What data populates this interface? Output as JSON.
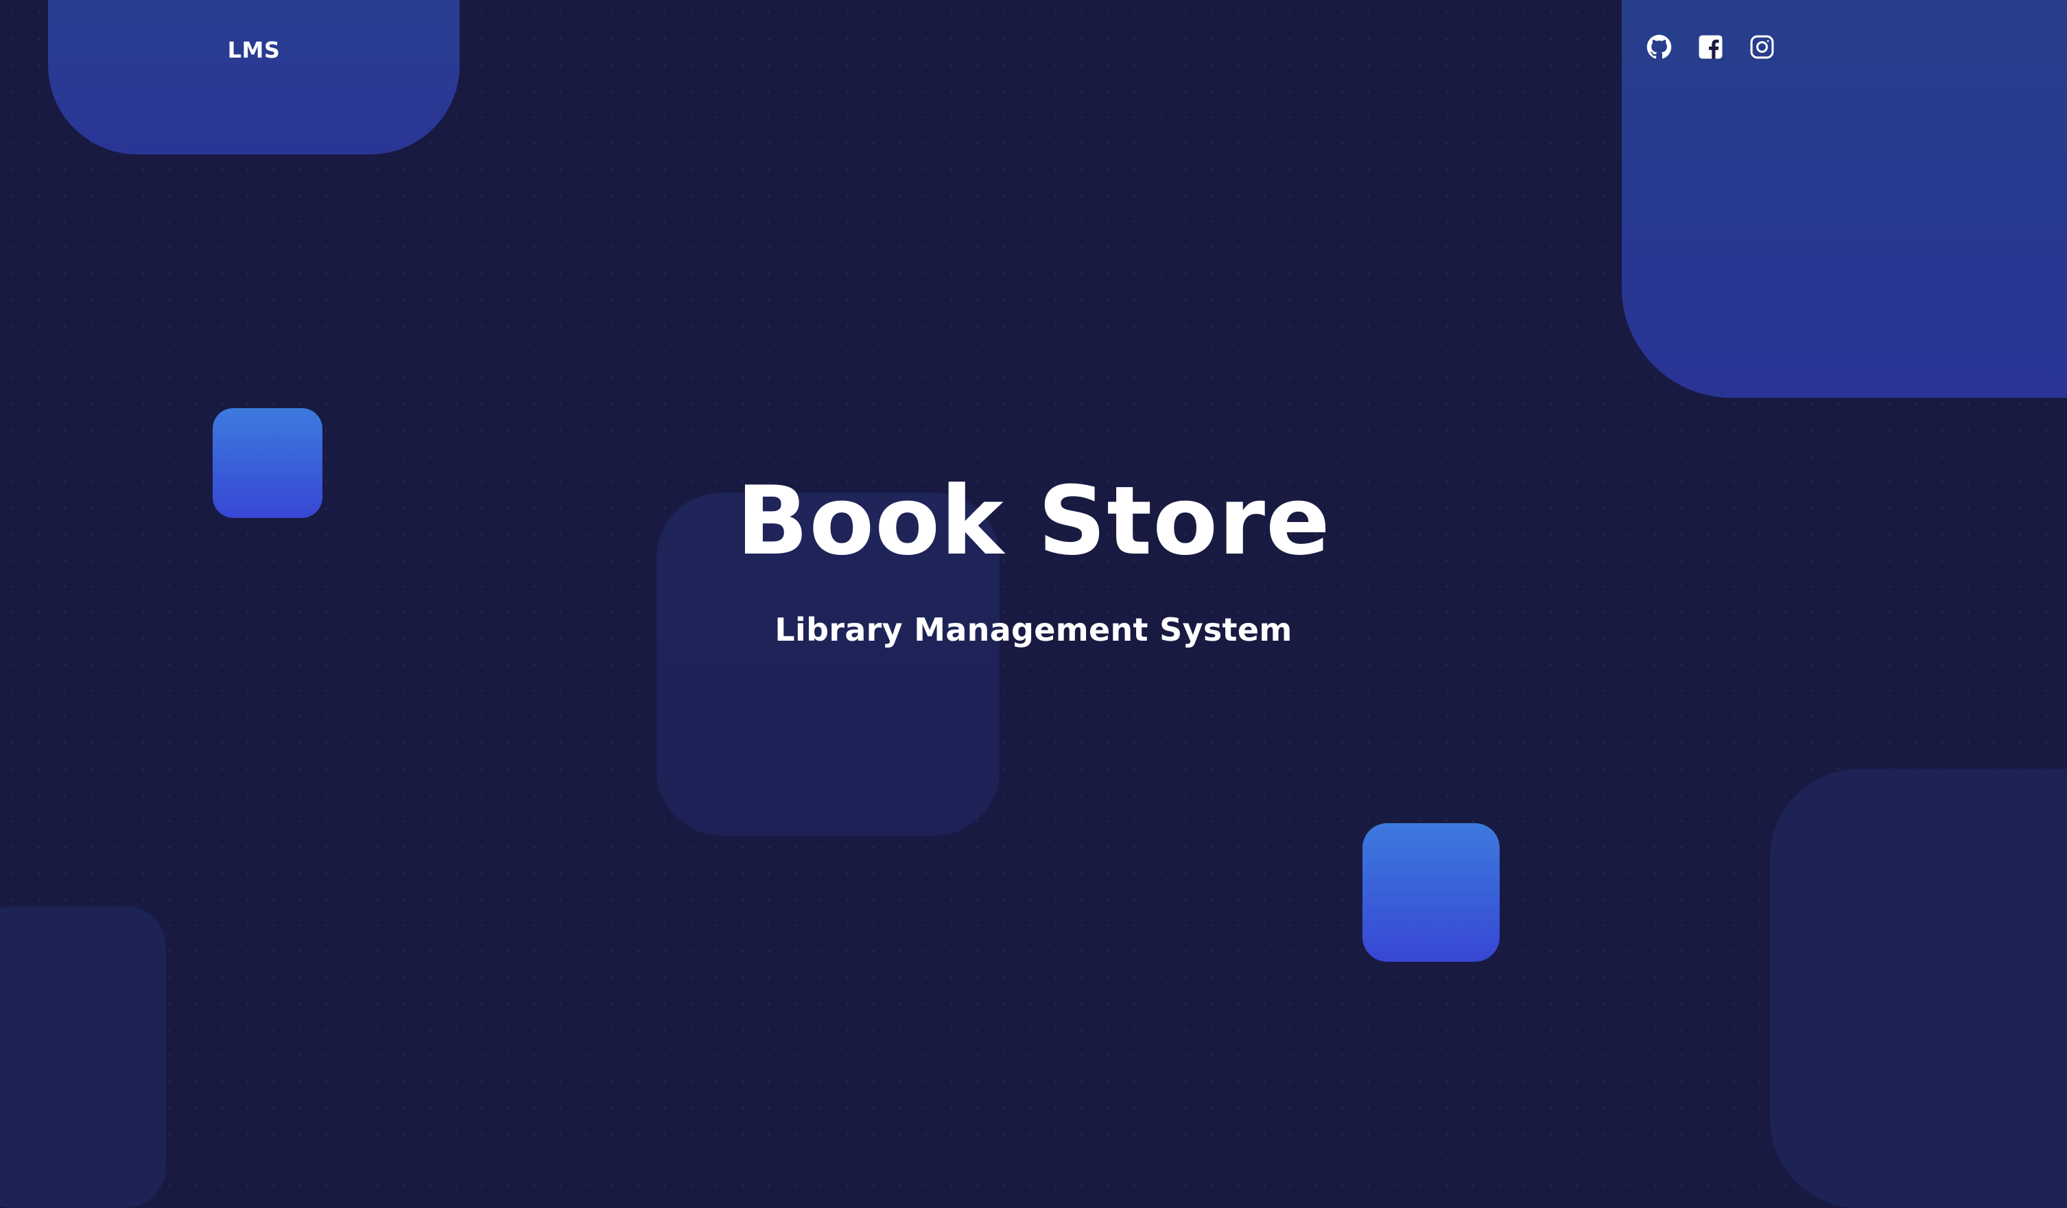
{
  "header": {
    "logo_text": "LMS",
    "social": [
      {
        "name": "GitHub",
        "icon": "github-icon"
      },
      {
        "name": "Facebook",
        "icon": "facebook-icon"
      },
      {
        "name": "Instagram",
        "icon": "instagram-icon"
      }
    ]
  },
  "hero": {
    "title": "Book Store",
    "subtitle": "Library Management System"
  },
  "colors": {
    "background": "#181a41",
    "accent_gradient_top": "#3d7ade",
    "accent_gradient_bottom": "#3747d4",
    "navy_block": "#2a3696",
    "text": "#ffffff"
  }
}
